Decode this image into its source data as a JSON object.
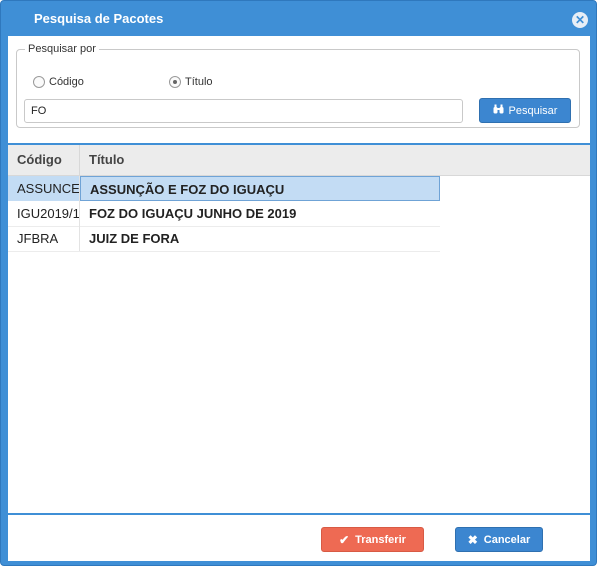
{
  "dialog": {
    "title": "Pesquisa de Pacotes",
    "close_icon": "close-circle-icon"
  },
  "search": {
    "legend": "Pesquisar por",
    "options": [
      {
        "label": "Código",
        "selected": false
      },
      {
        "label": "Título",
        "selected": true
      }
    ],
    "query": "FO",
    "button_label": "Pesquisar",
    "button_icon": "binoculars-icon"
  },
  "grid": {
    "columns": [
      "Código",
      "Título"
    ],
    "rows": [
      {
        "code": "ASSUNCE",
        "title": "ASSUNÇÃO E FOZ DO IGUAÇU",
        "selected": true
      },
      {
        "code": "IGU2019/1",
        "title": "FOZ DO IGUAÇU JUNHO DE 2019",
        "selected": false
      },
      {
        "code": "JFBRA",
        "title": "JUIZ DE FORA",
        "selected": false
      }
    ]
  },
  "footer": {
    "transfer_label": "Transferir",
    "transfer_icon": "check-icon",
    "cancel_label": "Cancelar",
    "cancel_icon": "x-icon"
  },
  "colors": {
    "accent": "#3f8fd6",
    "primary_button": "#3c86d0",
    "transfer_button": "#ee6a53",
    "selected_row": "#c3dcf4"
  }
}
